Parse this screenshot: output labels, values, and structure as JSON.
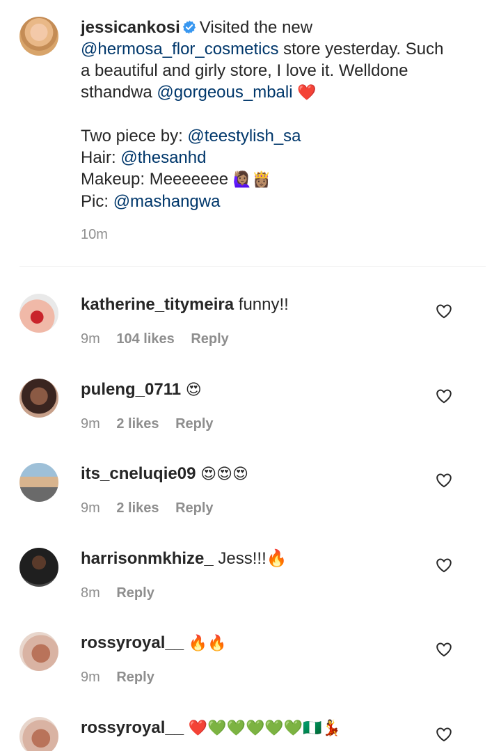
{
  "post": {
    "username": "jessicankosi",
    "caption_line1_text": "Visited the new",
    "mention_store": "@hermosa_flor_cosmetics",
    "caption_line2_rest": "store yesterday. Such",
    "caption_line3": "a beautiful and girly store, I love it. Welldone",
    "caption_line4_prefix": "sthandwa",
    "mention_owner": "@gorgeous_mbali",
    "caption_line4_emoji": "❤️",
    "credit1_label": "Two piece by:",
    "credit1_mention": "@teestylish_sa",
    "credit2_label": "Hair:",
    "credit2_mention": "@thesanhd",
    "credit3_label": "Makeup: Meeeeeee",
    "credit3_emoji": "🙋🏽‍♀️👸🏽",
    "credit4_label": "Pic:",
    "credit4_mention": "@mashangwa",
    "time": "10m"
  },
  "comments": [
    {
      "username": "katherine_titymeira",
      "text": "funny!!",
      "time": "9m",
      "likes": "104 likes",
      "reply": "Reply",
      "avatar_color": "#d99a9a"
    },
    {
      "username": "puleng_0711",
      "text": "😍",
      "time": "9m",
      "likes": "2 likes",
      "reply": "Reply",
      "avatar_color": "#7a4a3a"
    },
    {
      "username": "its_cneluqie09",
      "text": "😍😍😍",
      "time": "9m",
      "likes": "2 likes",
      "reply": "Reply",
      "avatar_color": "#b9b7b0"
    },
    {
      "username": "harrisonmkhize_",
      "text": "Jess!!!🔥",
      "time": "8m",
      "likes": "",
      "reply": "Reply",
      "avatar_color": "#3b3b3b"
    },
    {
      "username": "rossyroyal__",
      "text": "🔥🔥",
      "time": "9m",
      "likes": "",
      "reply": "Reply",
      "avatar_color": "#c98f78"
    },
    {
      "username": "rossyroyal__",
      "text": "❤️💚💚💚💚💚🇳🇬💃",
      "time": "",
      "likes": "",
      "reply": "",
      "avatar_color": "#c98f78"
    }
  ],
  "colors": {
    "text": "#262626",
    "mention": "#00376b",
    "meta": "#8e8e8e",
    "verified_badge": "#3897f0"
  },
  "icons": {
    "verified": "verified-badge-icon",
    "like": "heart-outline-icon"
  }
}
